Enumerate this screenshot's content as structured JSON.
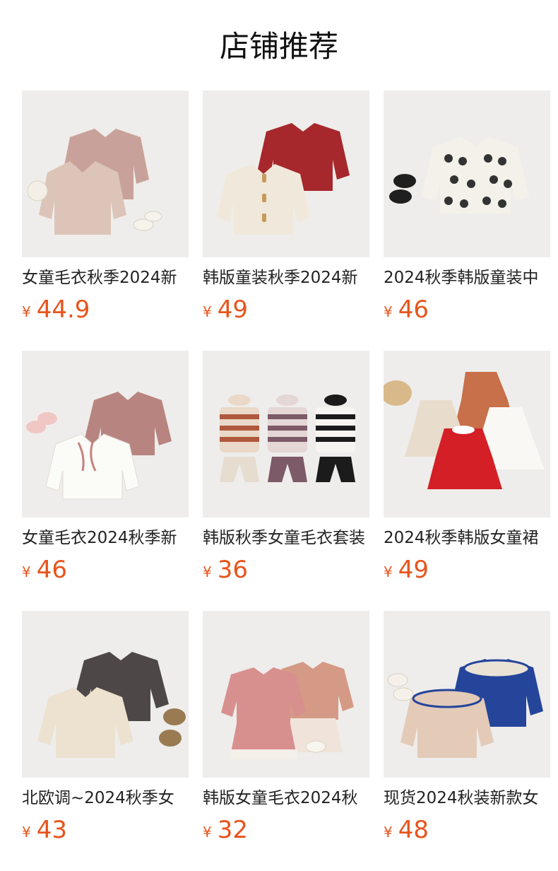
{
  "header": {
    "title": "店铺推荐"
  },
  "currency_symbol": "¥",
  "colors": {
    "price": "#e8541c",
    "title": "#111111"
  },
  "products": [
    {
      "name": "女童毛衣秋季2024新",
      "price": "44.9",
      "image": "pink-embroidered-cardigans-with-pearl-bag"
    },
    {
      "name": "韩版童装秋季2024新",
      "price": "49",
      "image": "cream-and-red-cable-knit-cardigans"
    },
    {
      "name": "2024秋季韩版童装中",
      "price": "46",
      "image": "heart-pattern-cardigan-with-shoes"
    },
    {
      "name": "女童毛衣2024秋季新",
      "price": "46",
      "image": "white-and-mauve-embroidered-cardigans"
    },
    {
      "name": "韩版秋季女童毛衣套装",
      "price": "36",
      "image": "striped-sweater-and-flare-pants-sets"
    },
    {
      "name": "2024秋季韩版女童裙",
      "price": "49",
      "image": "knit-dresses-with-ruffle-collar"
    },
    {
      "name": "北欧调~2024秋季女",
      "price": "43",
      "image": "cream-and-charcoal-knit-cardigans"
    },
    {
      "name": "韩版女童毛衣2024秋",
      "price": "32",
      "image": "pink-sweater-and-pleated-skirt-sets"
    },
    {
      "name": "现货2024秋装新款女",
      "price": "48",
      "image": "navy-and-beige-sailor-collar-cardigans"
    }
  ]
}
